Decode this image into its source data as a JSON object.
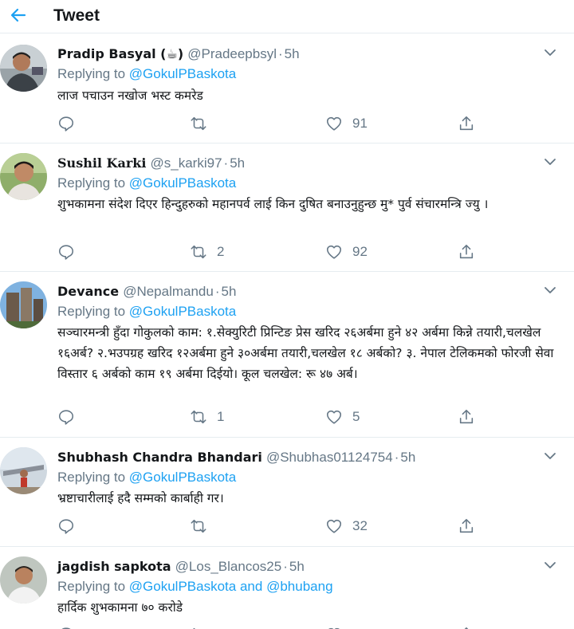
{
  "header": {
    "title": "Tweet",
    "back_icon": "arrow-left-icon",
    "accent": "#1da1f2"
  },
  "colors": {
    "mention": "#1da1f2",
    "meta": "#657786",
    "text": "#14171a",
    "divider": "#e6ecf0"
  },
  "replying_prefix": "Replying to",
  "tweets": [
    {
      "name": "Pradip Basyal (☕)",
      "handle": "@Pradeepbsyl",
      "time": "5h",
      "replying_to": "@GokulPBaskota",
      "text": "लाज पचाउन नखोज भस्ट कमरेड",
      "replies": "",
      "retweets": "",
      "likes": "91"
    },
    {
      "name": "Sushil Karki",
      "handle": "@s_karki97",
      "time": "5h",
      "replying_to": "@GokulPBaskota",
      "text": "शुभकामना संदेश दिएर हिन्दुहरुको महानपर्व लाई किन दुषित बनाउनुहुन्छ मु* पुर्व संचारमन्त्रि ज्यु ।",
      "replies": "",
      "retweets": "2",
      "likes": "92"
    },
    {
      "name": "Devance",
      "handle": "@Nepalmandu",
      "time": "5h",
      "replying_to": "@GokulPBaskota",
      "text": "सञ्चारमन्त्री हुँदा गोकुलको काम: १.सेक्युरिटी प्रिन्टिङ प्रेस खरिद २६अर्बमा हुने ४२ अर्बमा किन्ने तयारी,चलखेल १६अर्ब? २.भउपग्रह खरिद १२अर्बमा हुने ३०अर्बमा तयारी,चलखेल १८ अर्बको? ३. नेपाल टेलिकमको फोरजी सेवा विस्तार ६ अर्बको काम १९ अर्बमा दिईयो। कूल चलखेल: रू ४७ अर्ब।",
      "replies": "",
      "retweets": "1",
      "likes": "5"
    },
    {
      "name": "Shubhash Chandra Bhandari",
      "handle": "@Shubhas01124754",
      "time": "5h",
      "replying_to": "@GokulPBaskota",
      "text": "भ्रष्टाचारीलाई हदै सम्मको कार्बाही गर।",
      "replies": "",
      "retweets": "",
      "likes": "32"
    },
    {
      "name": "jagdish sapkota",
      "handle": "@Los_Blancos25",
      "time": "5h",
      "replying_to": "@GokulPBaskota",
      "replying_and": "and",
      "replying_to_2": "@bhubang",
      "text": "हार्दिक शुभकामना ७० करोडे",
      "replies": "",
      "retweets": "",
      "likes": ""
    }
  ]
}
